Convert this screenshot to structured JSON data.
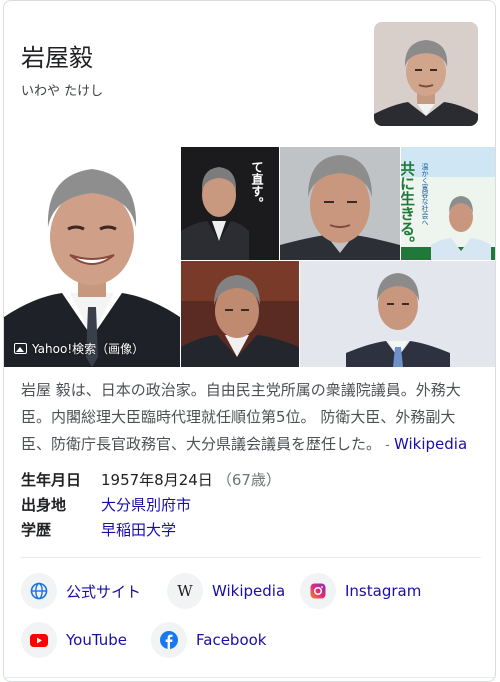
{
  "header": {
    "title": "岩屋毅",
    "subtitle": "いわや たけし"
  },
  "gallery": {
    "source_label": "Yahoo!検索（画像）",
    "poster1_text": "て直す。",
    "poster2_text": "共に生きる。",
    "poster2_sub": "温かく寛容な社会へ"
  },
  "description": {
    "text": "岩屋 毅は、日本の政治家。自由民主党所属の衆議院議員。外務大臣。内閣総理大臣臨時代理就任順位第5位。 防衛大臣、外務副大臣、防衛庁長官政務官、大分県議会議員を歴任した。",
    "source_sep": " - ",
    "source_link": "Wikipedia"
  },
  "facts": {
    "birth": {
      "label": "生年月日",
      "value": "1957年8月24日",
      "age": "（67歳）"
    },
    "origin": {
      "label": "出身地",
      "value": "大分県別府市"
    },
    "education": {
      "label": "学歴",
      "value": "早稲田大学"
    }
  },
  "links": {
    "official": "公式サイト",
    "wikipedia": "Wikipedia",
    "instagram": "Instagram",
    "youtube": "YouTube",
    "facebook": "Facebook"
  },
  "colors": {
    "link": "#1a0dab",
    "youtube": "#ff0000",
    "facebook": "#1877f2",
    "globe": "#1a73e8"
  }
}
